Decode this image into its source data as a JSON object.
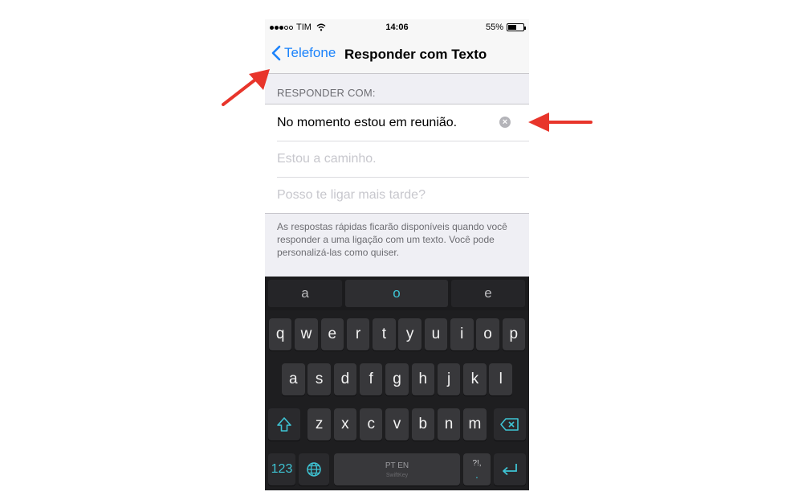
{
  "status_bar": {
    "carrier": "TIM",
    "time": "14:06",
    "battery": "55%",
    "battery_level": 0.55
  },
  "nav": {
    "back_label": "Telefone",
    "title": "Responder com Texto"
  },
  "section_header": "RESPONDER COM:",
  "responses": [
    {
      "text": "No momento estou em reunião.",
      "filled": true
    },
    {
      "text": "Estou a caminho.",
      "filled": false
    },
    {
      "text": "Posso te ligar mais tarde?",
      "filled": false
    }
  ],
  "footer_note": "As respostas rápidas ficarão disponíveis quando você responder a uma ligação com um texto. Você pode personalizá-las como quiser.",
  "keyboard": {
    "predictions": [
      "a",
      "o",
      "e"
    ],
    "rows": [
      [
        "q",
        "w",
        "e",
        "r",
        "t",
        "y",
        "u",
        "i",
        "o",
        "p"
      ],
      [
        "a",
        "s",
        "d",
        "f",
        "g",
        "h",
        "j",
        "k",
        "l"
      ],
      [
        "z",
        "x",
        "c",
        "v",
        "b",
        "n",
        "m"
      ]
    ],
    "numbers_label": "123",
    "space_label": "PT EN",
    "space_brand": "SwiftKey",
    "punct_label": "?!,",
    "punct_sub": ".",
    "accent_color": "#3ec4d4"
  },
  "annotation_color": "#e8352b"
}
